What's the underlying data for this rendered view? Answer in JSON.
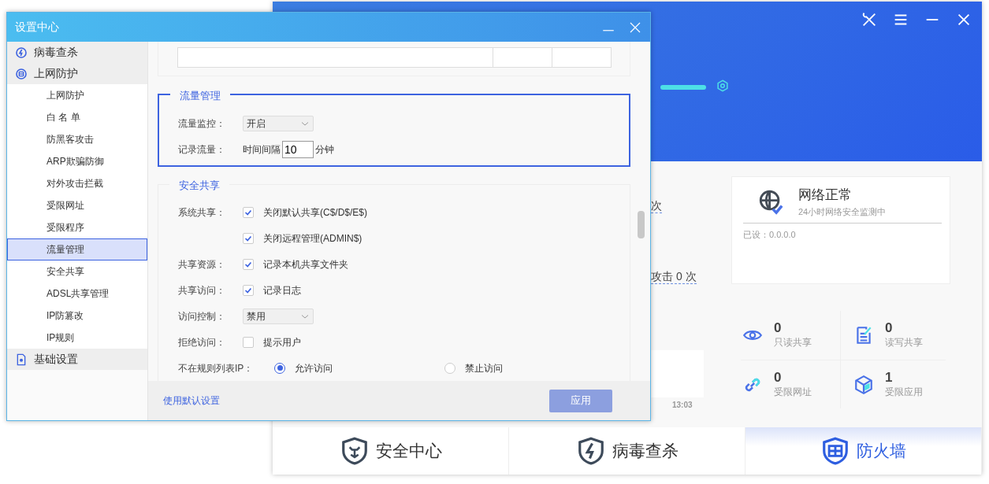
{
  "main_window": {
    "left_panel": {
      "texts": [
        "次",
        "攻击 0 次"
      ],
      "time": "13:03"
    },
    "network_card": {
      "title": "网络正常",
      "subtitle": "24小时网络安全监测中",
      "setting": "已设：0.0.0.0"
    },
    "stats": [
      {
        "kind": "eye",
        "value": "0",
        "label": "只读共享"
      },
      {
        "kind": "doc",
        "value": "0",
        "label": "读写共享"
      },
      {
        "kind": "link",
        "value": "0",
        "label": "受限网址"
      },
      {
        "kind": "cube",
        "value": "1",
        "label": "受限应用"
      }
    ],
    "bottom_tabs": [
      {
        "kind": "lion",
        "label": "安全中心",
        "selected": false
      },
      {
        "kind": "bolt",
        "label": "病毒查杀",
        "selected": false
      },
      {
        "kind": "wall",
        "label": "防火墙",
        "selected": true
      }
    ]
  },
  "dialog": {
    "title": "设置中心",
    "sidebar": [
      {
        "kind": "bolt",
        "label": "病毒查杀"
      },
      {
        "kind": "net",
        "label": "上网防护",
        "children": [
          {
            "label": "上网防护",
            "selected": false
          },
          {
            "label": "白 名 单",
            "selected": false
          },
          {
            "label": "防黑客攻击",
            "selected": false
          },
          {
            "label": "ARP欺骗防御",
            "selected": false
          },
          {
            "label": "对外攻击拦截",
            "selected": false
          },
          {
            "label": "受限网址",
            "selected": false
          },
          {
            "label": "受限程序",
            "selected": false
          },
          {
            "label": "流量管理",
            "selected": true
          },
          {
            "label": "安全共享",
            "selected": false
          },
          {
            "label": "ADSL共享管理",
            "selected": false
          },
          {
            "label": "IP防篡改",
            "selected": false
          },
          {
            "label": "IP规则",
            "selected": false
          }
        ]
      },
      {
        "kind": "doc",
        "label": "基础设置"
      }
    ],
    "sections": [
      {
        "title": "流量管理",
        "focused": true,
        "rows": [
          {
            "kind": "select",
            "label": "流量监控：",
            "value": "开启"
          },
          {
            "kind": "number",
            "label": "记录流量：",
            "prefix": "时间间隔",
            "value": "10",
            "suffix": "分钟"
          }
        ]
      },
      {
        "title": "安全共享",
        "focused": false,
        "rows": [
          {
            "kind": "checkbox",
            "label": "系统共享：",
            "text": "关闭默认共享(C$/D$/E$)",
            "checked": true
          },
          {
            "kind": "checkbox",
            "text": "关闭远程管理(ADMIN$)",
            "checked": true
          },
          {
            "kind": "checkbox",
            "label": "共享资源：",
            "text": "记录本机共享文件夹",
            "checked": true
          },
          {
            "kind": "checkbox",
            "label": "共享访问：",
            "text": "记录日志",
            "checked": true
          },
          {
            "kind": "select",
            "label": "访问控制：",
            "value": "禁用"
          },
          {
            "kind": "checkbox",
            "label": "拒绝访问：",
            "text": "提示用户",
            "checked": false
          },
          {
            "kind": "radio",
            "label": "不在规则列表IP：",
            "options": [
              {
                "text": "允许访问",
                "selected": true
              },
              {
                "text": "禁止访问",
                "selected": false
              }
            ]
          }
        ]
      }
    ],
    "default_link": "使用默认设置",
    "apply_button": "应用"
  }
}
